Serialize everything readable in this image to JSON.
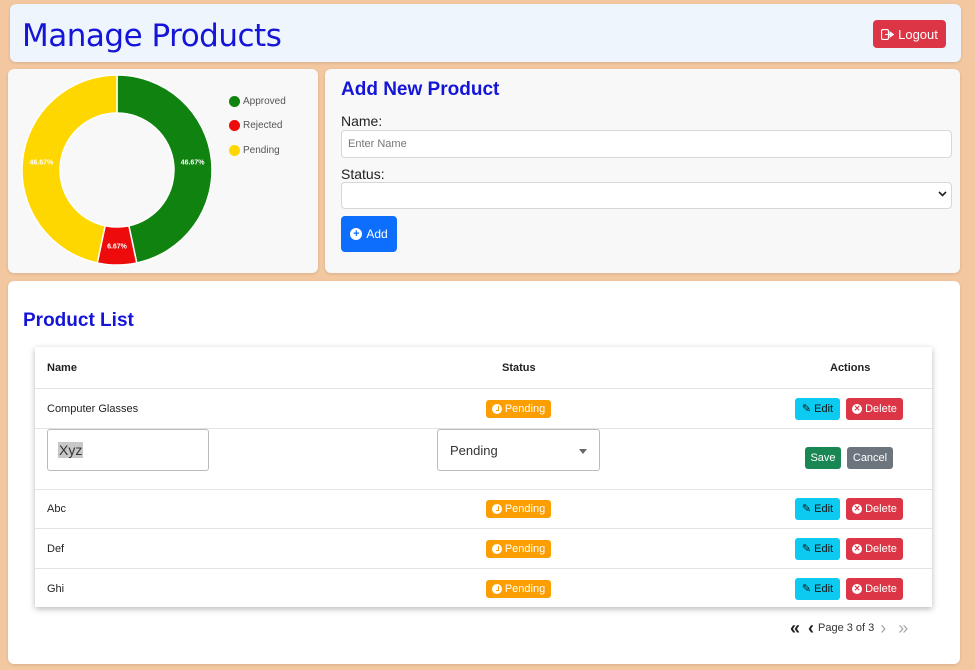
{
  "header": {
    "title": "Manage Products",
    "logout_label": "Logout"
  },
  "chart_data": {
    "type": "pie",
    "style": "donut",
    "categories": [
      "Approved",
      "Rejected",
      "Pending"
    ],
    "values": [
      46.67,
      6.67,
      46.67
    ],
    "labels": [
      "46.67%",
      "6.67%",
      "46.67%"
    ],
    "colors": [
      "#0f820f",
      "#ee0b0b",
      "#ffd700"
    ],
    "legend": "right"
  },
  "form": {
    "title": "Add New Product",
    "name_label": "Name:",
    "name_placeholder": "Enter Name",
    "status_label": "Status:",
    "status_value": "",
    "add_label": "Add"
  },
  "list": {
    "title": "Product List",
    "columns": [
      "Name",
      "Status",
      "Actions"
    ],
    "edit_label": "Edit",
    "delete_label": "Delete",
    "save_label": "Save",
    "cancel_label": "Cancel",
    "rows": [
      {
        "name": "Computer Glasses",
        "status": "Pending"
      },
      {
        "editing": true,
        "name_value": "Xyz",
        "status_value": "Pending"
      },
      {
        "name": "Abc",
        "status": "Pending"
      },
      {
        "name": "Def",
        "status": "Pending"
      },
      {
        "name": "Ghi",
        "status": "Pending"
      }
    ]
  },
  "pagination": {
    "text": "Page 3 of 3",
    "first": "«",
    "prev": "‹",
    "next": "›",
    "last": "»"
  }
}
